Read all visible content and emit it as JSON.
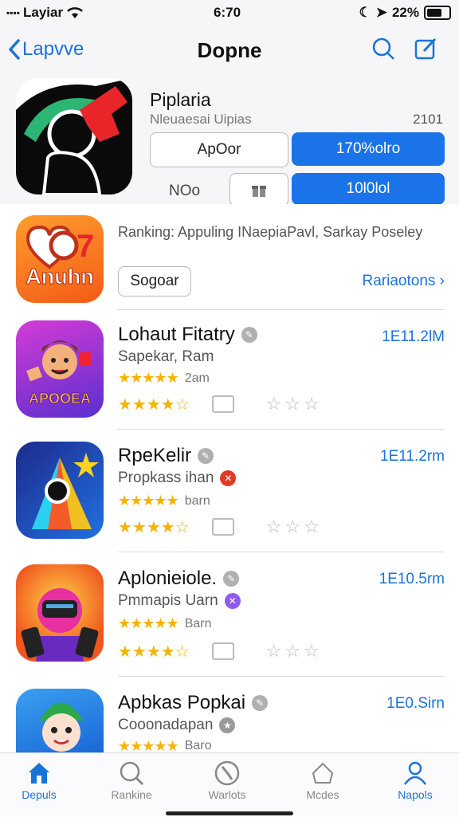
{
  "status": {
    "carrier": "Layiar",
    "time": "6:70",
    "battery": "22%"
  },
  "nav": {
    "back_label": "Lapvve",
    "title": "Dopne"
  },
  "featured": {
    "name": "Piplaria",
    "subtitle": "Nleuaesai Uipias",
    "number": "2101",
    "btn1": "ApOor",
    "btn2": "170%olro",
    "label": "NOo",
    "btn3": "10l0lol"
  },
  "ranking_row": {
    "icon_text": "Anuhn",
    "icon_number": "7",
    "text": "Ranking: Appuling INaepiaPavl, Sarkay Poseley",
    "button": "Sogoar",
    "link": "Rariaotons"
  },
  "apps": [
    {
      "name": "Lohaut Fitatry",
      "subtitle": "Sapekar, Ram",
      "stars_label": "2am",
      "size": "1E11.2lM",
      "icon_text": "APOOEA",
      "badge_color": "#b0b0b0"
    },
    {
      "name": "RpeKelir",
      "subtitle": "Propkass ihan",
      "stars_label": "barn",
      "size": "1E11.2rm",
      "icon_text": "",
      "badge_color": "#e03b2a"
    },
    {
      "name": "Aplonieiole.",
      "subtitle": "Pmmapis Uarn",
      "stars_label": "Barn",
      "size": "1E10.5rm",
      "icon_text": "",
      "badge_color": "#8e5cf0"
    },
    {
      "name": "Apbkas Popkai",
      "subtitle": "Cooonadapan",
      "stars_label": "Baro",
      "size": "1E0.Sirn",
      "icon_text": "",
      "badge_color": "#999999"
    }
  ],
  "tabs": [
    {
      "label": "Depuls",
      "icon": "home-icon",
      "active": true
    },
    {
      "label": "Rankine",
      "icon": "search-icon",
      "active": false
    },
    {
      "label": "Warlots",
      "icon": "compass-icon",
      "active": false
    },
    {
      "label": "Mcdes",
      "icon": "house-outline-icon",
      "active": false
    },
    {
      "label": "Napols",
      "icon": "person-icon",
      "active": false
    }
  ],
  "colors": {
    "accent": "#1a73e8",
    "star": "#f5b301"
  }
}
